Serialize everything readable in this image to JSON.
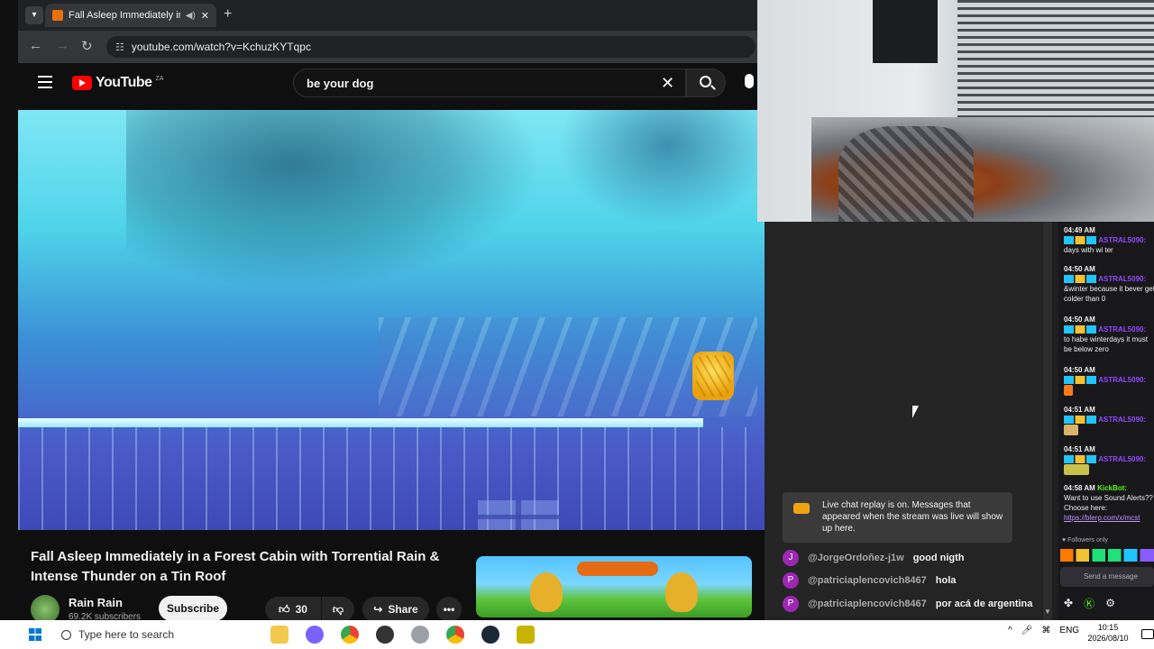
{
  "browser": {
    "tab_title": "Fall Asleep Immediately in a",
    "url": "youtube.com/watch?v=KchuzKYTqpc"
  },
  "youtube": {
    "logo_text": "YouTube",
    "country_code": "ZA",
    "search_value": "be your dog",
    "video_title": "Fall Asleep Immediately in a Forest Cabin with Torrential Rain & Intense Thunder on a Tin Roof",
    "channel_name": "Rain Rain",
    "subscribers": "69.2K subscribers",
    "subscribe_label": "Subscribe",
    "like_count": "30",
    "share_label": "Share"
  },
  "chat": {
    "replay_notice": "Live chat replay is on. Messages that appeared when the stream was live will show up here.",
    "messages": [
      {
        "initial": "J",
        "author": "@JorgeOrdoñez-j1w",
        "text": "good nigth"
      },
      {
        "initial": "P",
        "author": "@patriciaplencovich8467",
        "text": "hola"
      },
      {
        "initial": "P",
        "author": "@patriciaplencovich8467",
        "text": "por acá de argentina"
      }
    ]
  },
  "side_chat": {
    "messages": [
      {
        "time": "04:49 AM",
        "user": "ASTRAL5090:",
        "text": "days with wi ter"
      },
      {
        "time": "04:50 AM",
        "user": "ASTRAL5090:",
        "text": "&winter because it bever get colder than 0"
      },
      {
        "time": "04:50 AM",
        "user": "ASTRAL5090:",
        "text": "to habe winterdays it must be below zero"
      },
      {
        "time": "04:50 AM",
        "user": "ASTRAL5090:",
        "text": ""
      },
      {
        "time": "04:51 AM",
        "user": "ASTRAL5090:",
        "text": ""
      },
      {
        "time": "04:51 AM",
        "user": "ASTRAL5090:",
        "text": ""
      },
      {
        "time": "04:58 AM",
        "user": "KickBot:",
        "text": "Want to use Sound Alerts?? Choose here:",
        "link": "https://blerp.com/x/mcst"
      }
    ],
    "followers_only": "Followers only",
    "input_placeholder": "Send a message"
  },
  "taskbar": {
    "search_placeholder": "Type here to search",
    "language": "ENG",
    "time": "10:15",
    "date": "2026/08/10"
  },
  "colors": {
    "youtube_red": "#ff0000",
    "twitch_purple": "#9147ff",
    "kick_green": "#53fc18"
  }
}
